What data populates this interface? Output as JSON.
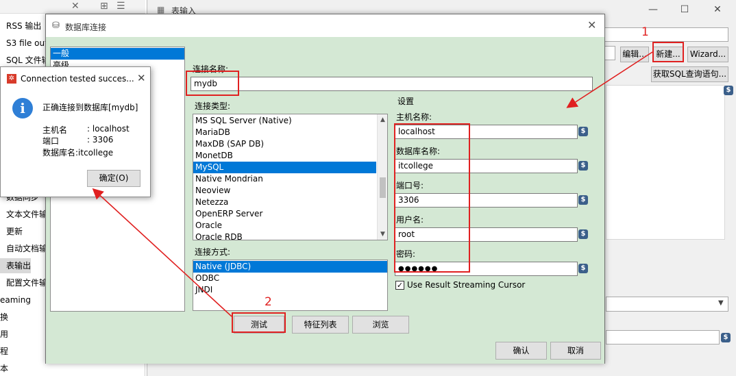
{
  "left_panel": {
    "items": [
      "RSS 输出",
      "S3 file out",
      "SQL 文件输",
      "数据同步",
      "文本文件输",
      "更新",
      "自动文档输",
      "表输出",
      "配置文件输",
      "eaming",
      "换",
      "用",
      "程",
      "本"
    ],
    "selected_item": "表输出"
  },
  "bg_window": {
    "title": "表输入",
    "buttons": {
      "edit": "编辑...",
      "new": "新建...",
      "wizard": "Wizard...",
      "get_sql": "获取SQL查询语句..."
    }
  },
  "dialog": {
    "title": "数据库连接",
    "categories": [
      "一般",
      "高级"
    ],
    "selected_category": "一般",
    "connection_name_label": "连接名称:",
    "connection_name_value": "mydb",
    "connection_type_label": "连接类型:",
    "connection_types": [
      "MS SQL Server (Native)",
      "MariaDB",
      "MaxDB (SAP DB)",
      "MonetDB",
      "MySQL",
      "Native Mondrian",
      "Neoview",
      "Netezza",
      "OpenERP Server",
      "Oracle",
      "Oracle RDB"
    ],
    "selected_type": "MySQL",
    "access_label": "连接方式:",
    "access_methods": [
      "Native (JDBC)",
      "ODBC",
      "JNDI"
    ],
    "selected_access": "Native (JDBC)",
    "settings_label": "设置",
    "host_label": "主机名称:",
    "host_value": "localhost",
    "db_label": "数据库名称:",
    "db_value": "itcollege",
    "port_label": "端口号:",
    "port_value": "3306",
    "user_label": "用户名:",
    "user_value": "root",
    "password_label": "密码:",
    "password_value": "●●●●●●",
    "streaming_label": "Use Result Streaming Cursor",
    "streaming_checked": true,
    "buttons": {
      "test": "测试",
      "features": "特征列表",
      "explore": "浏览",
      "ok": "确认",
      "cancel": "取消"
    }
  },
  "message": {
    "title": "Connection tested succes...",
    "line1": "正确连接到数据库[mydb]",
    "host_label": "主机名",
    "host_value": ": localhost",
    "port_label": "端口",
    "port_value": ": 3306",
    "db_line": "数据库名:itcollege",
    "ok_button": "确定(O)"
  },
  "annotations": {
    "step1": "1",
    "step2": "2",
    "color": "#e02020"
  }
}
